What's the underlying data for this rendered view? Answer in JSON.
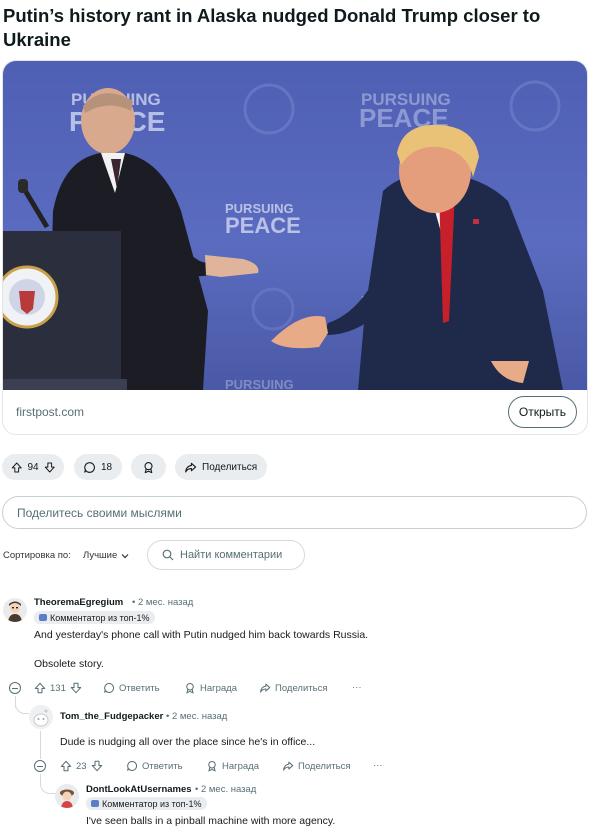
{
  "post": {
    "title": "Putin’s history rant in Alaska nudged Donald Trump closer to Ukraine",
    "link_domain": "firstpost.com",
    "open_button": "Открыть",
    "photo_texts": {
      "pursuing": "PURSUING",
      "peace": "PEACE"
    }
  },
  "actions": {
    "votes": "94",
    "comments": "18",
    "share": "Поделиться"
  },
  "composer": {
    "placeholder": "Поделитесь своими мыслями"
  },
  "sort": {
    "label": "Сортировка по:",
    "value": "Лучшие",
    "search_placeholder": "Найти комментарии"
  },
  "comments": [
    {
      "username": "TheoremaEgregium",
      "time": "• 2 мес. назад",
      "flair": "Комментатор из топ-1%",
      "lines": [
        "And yesterday's phone call with Putin nudged him back towards Russia.",
        "Obsolete story."
      ],
      "votes": "131",
      "reply": "Ответить",
      "award": "Награда",
      "share": "Поделиться",
      "more": "···"
    },
    {
      "username": "Tom_the_Fudgepacker",
      "time": "• 2 мес. назад",
      "lines": [
        "Dude is nudging all over the place since he's in office..."
      ],
      "votes": "23",
      "reply": "Ответить",
      "award": "Награда",
      "share": "Поделиться",
      "more": "···"
    },
    {
      "username": "DontLookAtUsernames",
      "time": "• 2 мес. назад",
      "flair": "Комментатор из топ-1%",
      "lines": [
        "I've seen balls in a pinball machine with more agency."
      ]
    }
  ],
  "colors": {
    "backdrop": "#5464b8",
    "pill_bg": "#eaedef",
    "text_secondary": "#576f76"
  }
}
